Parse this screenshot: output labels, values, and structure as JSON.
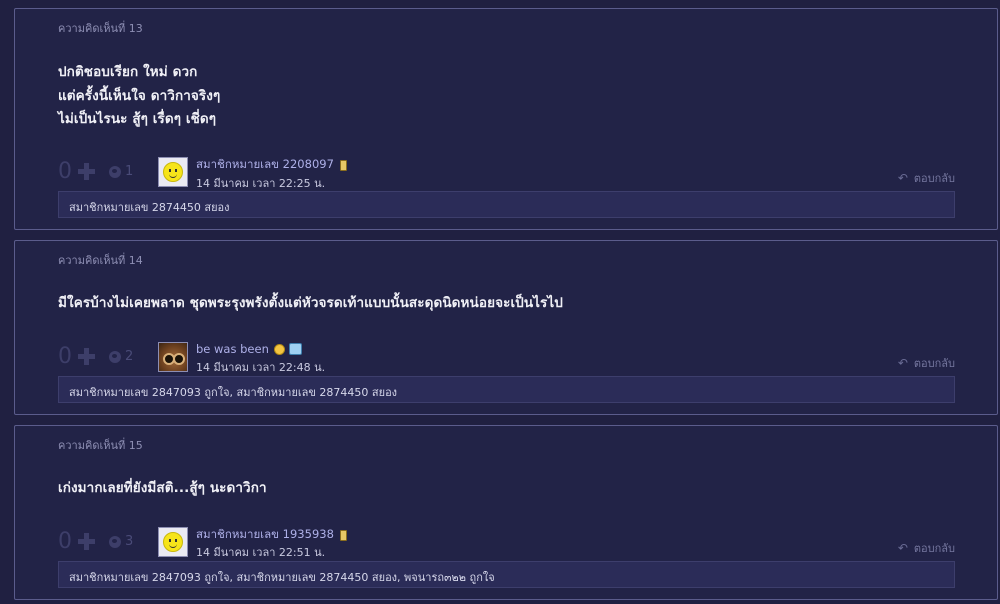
{
  "comments": [
    {
      "title": "ความคิดเห็นที่ 13",
      "lines": [
        "ปกติชอบเรียก ใหม่ ดวก",
        "แต่ครั้งนี้เห็นใจ ดาวิกาจริงๆ",
        "ไม่เป็นไรนะ สู้ๆ เรื่ดๆ เชี่ดๆ"
      ],
      "score": "0",
      "emotion_count": "1",
      "avatar": "smiley",
      "username": "สมาชิกหมายเลข 2208097",
      "user_icon": "mobile-icon",
      "date": "14 มีนาคม เวลา 22:25 น.",
      "reply": "ตอบกลับ",
      "reactions": "สมาชิกหมายเลข 2874450 สยอง"
    },
    {
      "title": "ความคิดเห็นที่ 14",
      "lines": [
        "มีใครบ้างไม่เคยพลาด ชุดพระรุงพรังตั้งแต่หัวจรดเท้าแบบนั้นสะดุดนิดหน่อยจะเป็นไรไป"
      ],
      "score": "0",
      "emotion_count": "2",
      "avatar": "owl",
      "username": "be was been",
      "user_icon": "laugh-icon",
      "date": "14 มีนาคม เวลา 22:48 น.",
      "reply": "ตอบกลับ",
      "reactions": "สมาชิกหมายเลข 2847093 ถูกใจ, สมาชิกหมายเลข 2874450 สยอง"
    },
    {
      "title": "ความคิดเห็นที่ 15",
      "lines": [
        "เก่งมากเลยที่ยังมีสติ...สู้ๆ นะดาวิกา"
      ],
      "score": "0",
      "emotion_count": "3",
      "avatar": "smiley",
      "username": "สมาชิกหมายเลข 1935938",
      "user_icon": "mobile-icon",
      "date": "14 มีนาคม เวลา 22:51 น.",
      "reply": "ตอบกลับ",
      "reactions": "สมาชิกหมายเลข 2847093 ถูกใจ, สมาชิกหมายเลข 2874450 สยอง, พจนารถ๓๒๒ ถูกใจ"
    }
  ]
}
